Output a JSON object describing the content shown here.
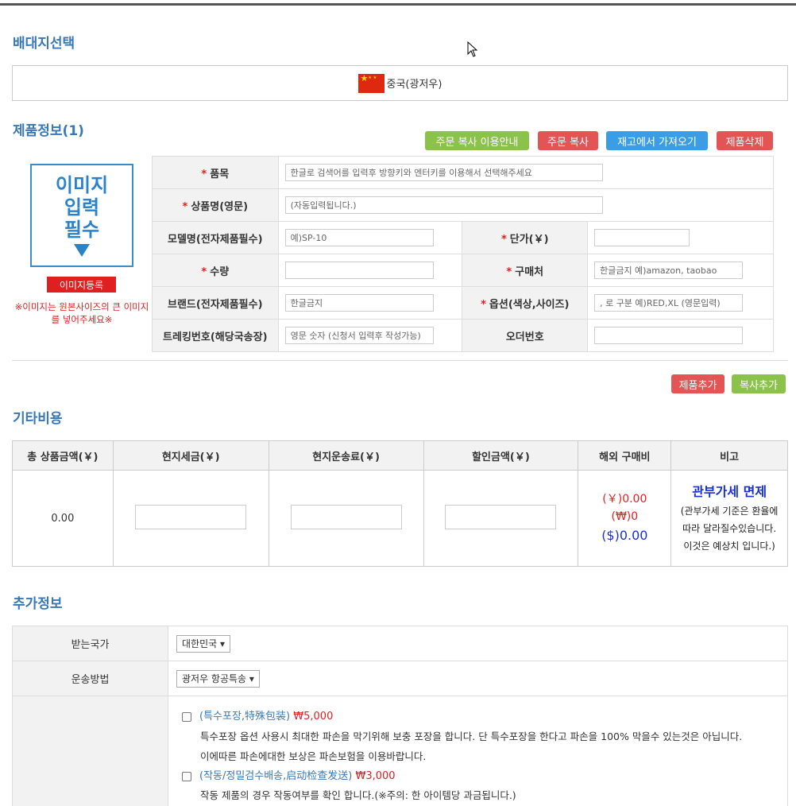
{
  "origin": {
    "title": "배대지선택",
    "selected": "중국(광저우)"
  },
  "product": {
    "title": "제품정보(1)",
    "buttons": {
      "copy_guide": "주문 복사 이용안내",
      "copy": "주문 복사",
      "from_stock": "재고에서 가져오기",
      "delete": "제품삭제"
    },
    "image": {
      "line1": "이미지",
      "line2": "입력",
      "line3": "필수",
      "register": "이미지등록",
      "note": "※이미지는 원본사이즈의 큰 이미지를 넣어주세요※"
    },
    "fields": {
      "item_label": "품목",
      "item_placeholder": "한글로 검색어를 입력후 방향키와 엔터키를 이용해서 선택해주세요",
      "name_label": "상품명(영문)",
      "name_placeholder": "(자동입력됩니다.)",
      "model_label": "모델명(전자제품필수)",
      "model_placeholder": "예)SP-10",
      "price_label": "단가(￥)",
      "price_value": "",
      "qty_label": "수량",
      "qty_value": "",
      "shop_label": "구매처",
      "shop_placeholder": "한글금지 예)amazon, taobao",
      "brand_label": "브랜드(전자제품필수)",
      "brand_placeholder": "한글금지",
      "option_label": "옵션(색상,사이즈)",
      "option_placeholder": ", 로 구분 예)RED,XL (영문입력)",
      "tracking_label": "트레킹번호(해당국송장)",
      "tracking_placeholder": "영문 숫자 (신청서 입력후 작성가능)",
      "order_label": "오더번호",
      "order_value": ""
    },
    "add_product": "제품추가",
    "copy_add": "복사추가"
  },
  "costs": {
    "title": "기타비용",
    "headers": [
      "총 상품금액(￥)",
      "현지세금(￥)",
      "현지운송료(￥)",
      "할인금액(￥)",
      "해외 구매비",
      "비고"
    ],
    "total": "0.00",
    "fee_cny": "(￥)0.00",
    "fee_krw": "(₩)0",
    "fee_usd": "($)0.00",
    "vat_title": "관부가세 면제",
    "vat_desc1": "(관부가세 기준은 환율에",
    "vat_desc2": "따라 달라질수있습니다.",
    "vat_desc3": "이것은 예상치 입니다.)"
  },
  "extra": {
    "title": "추가정보",
    "country_label": "받는국가",
    "country_value": "대한민국 ▾",
    "method_label": "운송방법",
    "method_value": "광저우 항공특송 ▾",
    "options": [
      {
        "title": "(특수포장,特殊包装)",
        "price": "₩5,000",
        "desc1": "특수포장 옵션 사용시 최대한 파손을 막기위해 보충 포장을 합니다. 단 특수포장을 한다고 파손을 100% 막을수 있는것은 아닙니다.",
        "desc2": "이에따른 파손에대한 보상은 파손보험을 이용바랍니다."
      },
      {
        "title": "(작동/정밀검수배송,启动检查发送)",
        "price": "₩3,000",
        "desc1": "작동 제품의 경우 작동여부를 확인 합니다.(※주의: 한 아이템당 과금됩니다.)"
      }
    ]
  }
}
